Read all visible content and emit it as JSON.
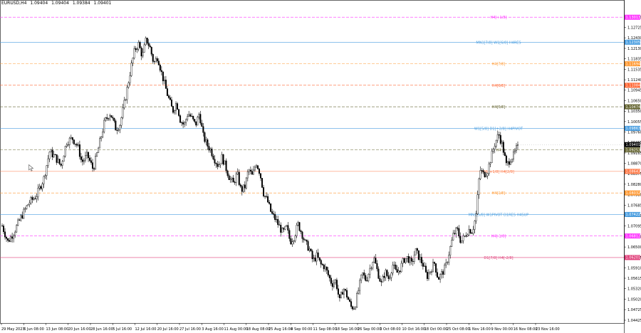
{
  "chart_header": {
    "symbol_timeframe": "EURUSD,H4",
    "open": "1.09404",
    "high": "1.09404",
    "low": "1.09384",
    "close": "1.09401"
  },
  "colors": {
    "background": "#ffffff",
    "candle": "#000000",
    "magenta": "#ff33ff",
    "blue": "#4a9ee0",
    "orange": "#ff9933",
    "red_orange": "#ff6633",
    "olive": "#666633",
    "salmon": "#ff7744",
    "crimson": "#e0407a",
    "grey_dash": "#999999"
  },
  "chart_data": {
    "type": "candlestick",
    "ylim": [
      1.04425,
      1.1332
    ],
    "price_ticks": [
      "1.13020",
      "1.12725",
      "1.12430",
      "1.12130",
      "1.11835",
      "1.11535",
      "1.11240",
      "1.10945",
      "1.10650",
      "1.10350",
      "1.10055",
      "1.09760",
      "1.09465",
      "1.09165",
      "1.08870",
      "1.08575",
      "1.08280",
      "1.07980",
      "1.07685",
      "1.07390",
      "1.07095",
      "1.06800",
      "1.06500",
      "1.06205",
      "1.05910",
      "1.05615",
      "1.05320",
      "1.05020",
      "1.04725",
      "1.04425"
    ],
    "time_labels": [
      "29 May 2023",
      "6 Jun 08:00",
      "13 Jun 08:00",
      "20 Jun 16:00",
      "28 Jun 16:00",
      "5 Jul 16:00",
      "12 Jul 16:00",
      "20 Jul 16:00",
      "27 Jul 16:00",
      "3 Aug 16:00",
      "11 Aug 00:00",
      "18 Aug 08:00",
      "25 Aug 16:00",
      "4 Sep 00:00",
      "11 Sep 08:00",
      "18 Sep 16:00",
      "26 Sep 00:00",
      "3 Oct 08:00",
      "10 Oct 16:00",
      "18 Oct 00:00",
      "25 Oct 08:00",
      "1 Nov 16:00",
      "9 Nov 00:00",
      "16 Nov 08:00",
      "23 Nov 16:00"
    ],
    "levels": [
      {
        "label": "H4[+1/8]",
        "price": "1.13013",
        "value": 1.13013,
        "color": "#ff33ff",
        "style": "dash",
        "badge": "1.13013"
      },
      {
        "label": "MN1[7/8] W1[6/8] H4RES",
        "price": "1.12305",
        "value": 1.12305,
        "color": "#4a9ee0",
        "style": "solid",
        "badge": "1.12305"
      },
      {
        "label": "H4[7/8]",
        "price": "1.11694",
        "value": 1.11694,
        "color": "#ff9933",
        "style": "dash",
        "badge": "1.11694"
      },
      {
        "label": "H4[6/8]",
        "price": "1.11084",
        "value": 1.11084,
        "color": "#ff6633",
        "style": "dash",
        "badge": "1.11084"
      },
      {
        "label": "H4[5/8]",
        "price": "1.10474",
        "value": 1.10474,
        "color": "#666633",
        "style": "dash",
        "badge": "1.10474"
      },
      {
        "label": "W1[5/8] D1[+2/8] H4PIVOT",
        "price": "1.09863",
        "value": 1.09863,
        "color": "#4a9ee0",
        "style": "solid",
        "badge": "1.09863"
      },
      {
        "label": "",
        "price": "1.09401",
        "value": 1.09401,
        "color": "#000000",
        "style": "none",
        "badge": "1.09401"
      },
      {
        "label": "H4",
        "price": "1.09253",
        "value": 1.09253,
        "color": "#666633",
        "style": "dash",
        "badge": "1.09253"
      },
      {
        "label": "D1[+1/8] H4[2/8]",
        "price": "1.08643",
        "value": 1.08643,
        "color": "#ff7744",
        "style": "solid",
        "badge": "1.08643"
      },
      {
        "label": "H4[1/8]",
        "price": "1.08032",
        "value": 1.08032,
        "color": "#ff9933",
        "style": "dash",
        "badge": "1.08032"
      },
      {
        "label": "MN1[5/8] W1PIVOT D1RES H4SUP",
        "price": "1.07422",
        "value": 1.07422,
        "color": "#4a9ee0",
        "style": "solid",
        "badge": "1.07422"
      },
      {
        "label": "H4[-1/8]",
        "price": "1.06812",
        "value": 1.06812,
        "color": "#ff33ff",
        "style": "dash",
        "badge": "1.06812"
      },
      {
        "label": "D1[7/8] H4[-2/8]",
        "price": "1.06201",
        "value": 1.06201,
        "color": "#e0407a",
        "style": "solid",
        "badge": "1.06201"
      }
    ],
    "path_anchors": [
      [
        0,
        1.071
      ],
      [
        3,
        1.0665
      ],
      [
        6,
        1.069
      ],
      [
        10,
        1.0735
      ],
      [
        14,
        1.0775
      ],
      [
        18,
        1.0795
      ],
      [
        22,
        1.0845
      ],
      [
        25,
        1.092
      ],
      [
        28,
        1.0905
      ],
      [
        31,
        1.088
      ],
      [
        34,
        1.0948
      ],
      [
        37,
        1.0958
      ],
      [
        40,
        1.0935
      ],
      [
        42,
        1.089
      ],
      [
        45,
        1.091
      ],
      [
        48,
        1.087
      ],
      [
        51,
        1.0935
      ],
      [
        54,
        1.1005
      ],
      [
        57,
        1.103
      ],
      [
        60,
        1.0985
      ],
      [
        62,
        1.0995
      ],
      [
        64,
        1.1045
      ],
      [
        66,
        1.11
      ],
      [
        68,
        1.116
      ],
      [
        70,
        1.121
      ],
      [
        72,
        1.1225
      ],
      [
        74,
        1.119
      ],
      [
        76,
        1.124
      ],
      [
        78,
        1.1215
      ],
      [
        80,
        1.117
      ],
      [
        82,
        1.119
      ],
      [
        84,
        1.1145
      ],
      [
        87,
        1.1085
      ],
      [
        90,
        1.1035
      ],
      [
        92,
        1.106
      ],
      [
        94,
        1.101
      ],
      [
        96,
        1.0995
      ],
      [
        98,
        1.103
      ],
      [
        100,
        1.1015
      ],
      [
        102,
        1.0995
      ],
      [
        104,
        1.103
      ],
      [
        106,
        1.0965
      ],
      [
        108,
        1.094
      ],
      [
        110,
        1.0925
      ],
      [
        112,
        1.09
      ],
      [
        114,
        1.088
      ],
      [
        116,
        1.0905
      ],
      [
        118,
        1.0875
      ],
      [
        120,
        1.0845
      ],
      [
        122,
        1.083
      ],
      [
        124,
        1.0858
      ],
      [
        126,
        1.081
      ],
      [
        128,
        1.082
      ],
      [
        130,
        1.087
      ],
      [
        132,
        1.085
      ],
      [
        134,
        1.089
      ],
      [
        136,
        1.086
      ],
      [
        138,
        1.08
      ],
      [
        140,
        1.078
      ],
      [
        142,
        1.0745
      ],
      [
        144,
        1.073
      ],
      [
        146,
        1.071
      ],
      [
        148,
        1.069
      ],
      [
        150,
        1.0705
      ],
      [
        152,
        1.0665
      ],
      [
        154,
        1.068
      ],
      [
        156,
        1.0715
      ],
      [
        158,
        1.069
      ],
      [
        160,
        1.066
      ],
      [
        162,
        1.0645
      ],
      [
        164,
        1.061
      ],
      [
        166,
        1.0625
      ],
      [
        168,
        1.06
      ],
      [
        170,
        1.0595
      ],
      [
        172,
        1.057
      ],
      [
        174,
        1.0545
      ],
      [
        176,
        1.0555
      ],
      [
        178,
        1.0495
      ],
      [
        180,
        1.0535
      ],
      [
        182,
        1.051
      ],
      [
        184,
        1.048
      ],
      [
        186,
        1.048
      ],
      [
        188,
        1.053
      ],
      [
        190,
        1.0575
      ],
      [
        192,
        1.0555
      ],
      [
        194,
        1.059
      ],
      [
        196,
        1.062
      ],
      [
        198,
        1.058
      ],
      [
        200,
        1.0545
      ],
      [
        202,
        1.058
      ],
      [
        204,
        1.056
      ],
      [
        206,
        1.06
      ],
      [
        208,
        1.0575
      ],
      [
        210,
        1.059
      ],
      [
        212,
        1.0615
      ],
      [
        214,
        1.062
      ],
      [
        216,
        1.06
      ],
      [
        218,
        1.064
      ],
      [
        220,
        1.062
      ],
      [
        222,
        1.06
      ],
      [
        224,
        1.0565
      ],
      [
        226,
        1.0585
      ],
      [
        228,
        1.0605
      ],
      [
        230,
        1.056
      ],
      [
        232,
        1.0575
      ],
      [
        234,
        1.0595
      ],
      [
        236,
        1.064
      ],
      [
        238,
        1.0685
      ],
      [
        240,
        1.07
      ],
      [
        242,
        1.0665
      ],
      [
        244,
        1.068
      ],
      [
        246,
        1.07
      ],
      [
        248,
        1.0695
      ],
      [
        250,
        1.074
      ],
      [
        252,
        1.087
      ],
      [
        254,
        1.0855
      ],
      [
        256,
        1.0865
      ],
      [
        258,
        1.0905
      ],
      [
        260,
        1.0945
      ],
      [
        262,
        1.097
      ],
      [
        264,
        1.0935
      ],
      [
        266,
        1.088
      ],
      [
        268,
        1.09
      ],
      [
        270,
        1.091
      ],
      [
        272,
        1.094
      ]
    ]
  }
}
